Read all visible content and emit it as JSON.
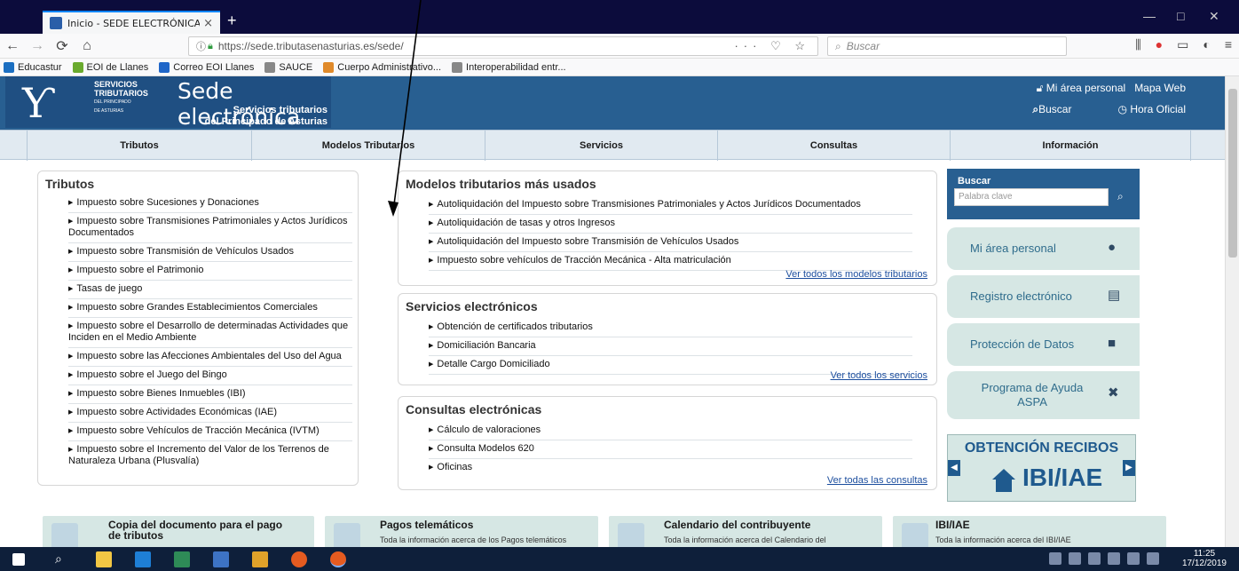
{
  "browser": {
    "tab_title": "Inicio - SEDE ELECTRÓNICA ST",
    "tab_close": "×",
    "new_tab": "+",
    "win_minimize": "—",
    "win_maximize": "□",
    "win_close": "✕",
    "url": "https://sede.tributasenasturias.es/sede/",
    "url_actions": "··· ♡ ☆",
    "search_placeholder": "Buscar",
    "bookmarks": [
      {
        "label": "Educastur",
        "color": "#1c6fc1"
      },
      {
        "label": "EOI de Llanes",
        "color": "#6aaa2e"
      },
      {
        "label": "Correo EOI Llanes",
        "color": "#1f66c8"
      },
      {
        "label": "SAUCE",
        "color": "#888888"
      },
      {
        "label": "Cuerpo Administrativo...",
        "color": "#e08a2a"
      },
      {
        "label": "Interoperabilidad entr...",
        "color": "#888888"
      }
    ]
  },
  "header": {
    "org_line1": "SERVICIOS",
    "org_line2": "TRIBUTARIOS",
    "org_line3": "DEL PRINCIPADO",
    "org_line4": "DE ASTURIAS",
    "site_title": "Sede electrónica",
    "site_sub1": "Servicios tributarios",
    "site_sub2": "del Principado de Asturias",
    "link_personal": "Mi área personal",
    "link_map": "Mapa Web",
    "link_search": "Buscar",
    "link_time": "Hora Oficial"
  },
  "nav": {
    "items": [
      {
        "label": "Tributos"
      },
      {
        "label": "Modelos Tributarios"
      },
      {
        "label": "Servicios"
      },
      {
        "label": "Consultas"
      },
      {
        "label": "Información"
      }
    ]
  },
  "tributos": {
    "title": "Tributos",
    "items": [
      "Impuesto sobre Sucesiones y Donaciones",
      "Impuesto sobre Transmisiones Patrimoniales y Actos Jurídicos Documentados",
      "Impuesto sobre Transmisión de Vehículos Usados",
      "Impuesto sobre el Patrimonio",
      "Tasas de juego",
      "Impuesto sobre Grandes Establecimientos Comerciales",
      "Impuesto sobre el Desarrollo de determinadas Actividades que Inciden en el Medio Ambiente",
      "Impuesto sobre las Afecciones Ambientales del Uso del Agua",
      "Impuesto sobre el Juego del Bingo",
      "Impuesto sobre Bienes Inmuebles (IBI)",
      "Impuesto sobre Actividades Económicas (IAE)",
      "Impuesto sobre Vehículos de Tracción Mecánica (IVTM)",
      "Impuesto sobre el Incremento del Valor de los Terrenos de Naturaleza Urbana (Plusvalía)"
    ]
  },
  "modelos": {
    "title": "Modelos tributarios más usados",
    "items": [
      "Autoliquidación del Impuesto sobre Transmisiones Patrimoniales y Actos Jurídicos Documentados",
      "Autoliquidación de tasas y otros Ingresos",
      "Autoliquidación del Impuesto sobre Transmisión de Vehículos Usados",
      "Impuesto sobre vehículos de Tracción Mecánica - Alta matriculación"
    ],
    "more": "Ver todos los modelos tributarios"
  },
  "servicios": {
    "title": "Servicios electrónicos",
    "items": [
      "Obtención de certificados tributarios",
      "Domiciliación Bancaria",
      "Detalle Cargo Domiciliado"
    ],
    "more": "Ver todos los servicios"
  },
  "consultas": {
    "title": "Consultas electrónicas",
    "items": [
      "Cálculo de valoraciones",
      "Consulta Modelos 620",
      "Oficinas"
    ],
    "more": "Ver todas las consultas"
  },
  "sidebar": {
    "search_label": "Buscar",
    "search_placeholder": "Palabra clave",
    "buttons": [
      {
        "label": "Mi área personal",
        "icon": "user-icon"
      },
      {
        "label": "Registro electrónico",
        "icon": "document-icon"
      },
      {
        "label": "Protección de Datos",
        "icon": "lock-icon"
      },
      {
        "label": "Programa de Ayuda ASPA",
        "icon": "tools-icon"
      }
    ],
    "banner_line1": "OBTENCIÓN RECIBOS",
    "banner_line2": "IBI/IAE"
  },
  "footer_cards": [
    {
      "title": "Copia del documento para el pago de tributos",
      "sub": ""
    },
    {
      "title": "Pagos telemáticos",
      "sub": "Toda la información acerca de los Pagos telemáticos"
    },
    {
      "title": "Calendario del contribuyente",
      "sub": "Toda la información acerca del Calendario del"
    },
    {
      "title": "IBI/IAE",
      "sub": "Toda la información acerca del IBI/IAE"
    }
  ],
  "taskbar": {
    "time": "11:25",
    "date": "17/12/2019"
  }
}
